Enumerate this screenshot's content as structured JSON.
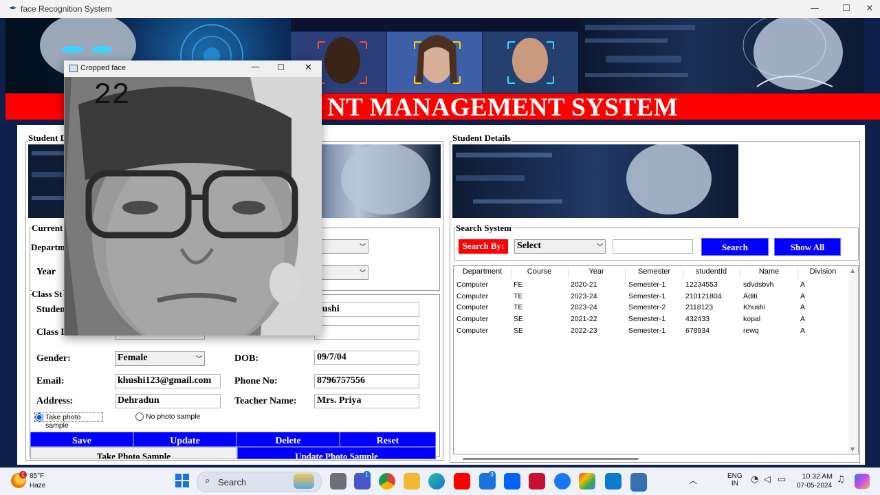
{
  "window": {
    "title": "face Recognition System"
  },
  "banner": {
    "title": "NT MANAGEMENT SYSTEM"
  },
  "left_panel": {
    "frame_title": "Student D",
    "current_course": {
      "frame_title": "Current",
      "department_label": "Departm",
      "year_label": "Year"
    },
    "class_student": {
      "frame_title": "Class St",
      "student_name_label": "Studen",
      "student_name_value": "hushi",
      "class_division_label": "Class D",
      "gender_label": "Gender:",
      "gender_value": "Female",
      "dob_label": "DOB:",
      "dob_value": "09/7/04",
      "email_label": "Email:",
      "email_value": "khushi123@gmail.com",
      "phone_label": "Phone No:",
      "phone_value": "8796757556",
      "address_label": "Address:",
      "address_value": "Dehradun",
      "teacher_label": "Teacher Name:",
      "teacher_value": "Mrs. Priya",
      "radio_take": "Take photo sample",
      "radio_no": "No photo sample"
    },
    "buttons": {
      "save": "Save",
      "update": "Update",
      "delete": "Delete",
      "reset": "Reset",
      "take_photo": "Take Photo Sample",
      "update_photo": "Update Photo Sample"
    }
  },
  "right_panel": {
    "frame_title": "Student Details",
    "search": {
      "frame_title": "Search System",
      "search_by_label": "Search By:",
      "select_value": "Select",
      "search_button": "Search",
      "show_all_button": "Show All"
    },
    "table": {
      "columns": [
        "Department",
        "Course",
        "Year",
        "Semester",
        "studentId",
        "Name",
        "Division"
      ],
      "rows": [
        [
          "Computer",
          "FE",
          "2020-21",
          "Semester-1",
          "12234553",
          "sdvdsbvh",
          "A"
        ],
        [
          "Computer",
          "TE",
          "2023-24",
          "Semester-1",
          "210121804",
          "Aditi",
          "A"
        ],
        [
          "Computer",
          "TE",
          "2023-24",
          "Semester-2",
          "2118123",
          "Khushi",
          "A"
        ],
        [
          "Computer",
          "SE",
          "2021-22",
          "Semester-1",
          "432433",
          "kopal",
          "A"
        ],
        [
          "Computer",
          "SE",
          "2022-23",
          "Semester-1",
          "678934",
          "rewq",
          "A"
        ]
      ]
    }
  },
  "cropped_window": {
    "title": "Cropped face",
    "counter": "22"
  },
  "taskbar": {
    "weather_temp": "85°F",
    "weather_desc": "Haze",
    "weather_badge": "1",
    "search_placeholder": "Search",
    "teams_badge": "1",
    "mail_badge": "3",
    "lang_top": "ENG",
    "lang_bottom": "IN",
    "time": "10:32 AM",
    "date": "07-05-2024"
  },
  "colors": {
    "accent_blue": "#0000ff",
    "banner_red": "#ff0000",
    "frame_navy": "#0e1f4a"
  }
}
